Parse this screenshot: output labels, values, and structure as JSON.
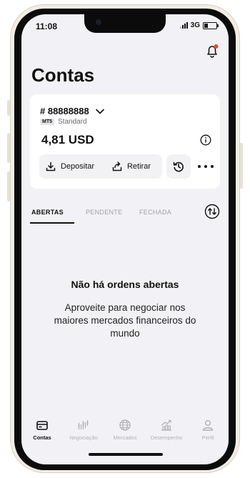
{
  "status": {
    "time": "11:08",
    "network": "3G"
  },
  "page": {
    "title": "Contas"
  },
  "account": {
    "number": "# 88888888",
    "platform_badge": "MT5",
    "type": "Standard",
    "balance": "4,81 USD",
    "deposit_label": "Depositar",
    "withdraw_label": "Retirar"
  },
  "tabs": [
    {
      "label": "ABERTAS",
      "active": true
    },
    {
      "label": "PENDENTE",
      "active": false
    },
    {
      "label": "FECHADA",
      "active": false
    }
  ],
  "empty_state": {
    "title": "Não há ordens abertas",
    "description": "Aproveite para negociar nos maiores mercados financeiros do mundo"
  },
  "bottom_nav": [
    {
      "label": "Contas",
      "icon": "wallet-icon",
      "active": true
    },
    {
      "label": "Negociação",
      "icon": "candlestick-icon",
      "active": false
    },
    {
      "label": "Mercados",
      "icon": "globe-icon",
      "active": false
    },
    {
      "label": "Desempenho",
      "icon": "performance-chart-icon",
      "active": false
    },
    {
      "label": "Perfil",
      "icon": "user-icon",
      "active": false
    }
  ],
  "colors": {
    "notification_dot": "#e5483b",
    "text": "#111111",
    "inactive": "#b0b0b6",
    "card": "#ffffff",
    "background": "#f2f2f6"
  }
}
